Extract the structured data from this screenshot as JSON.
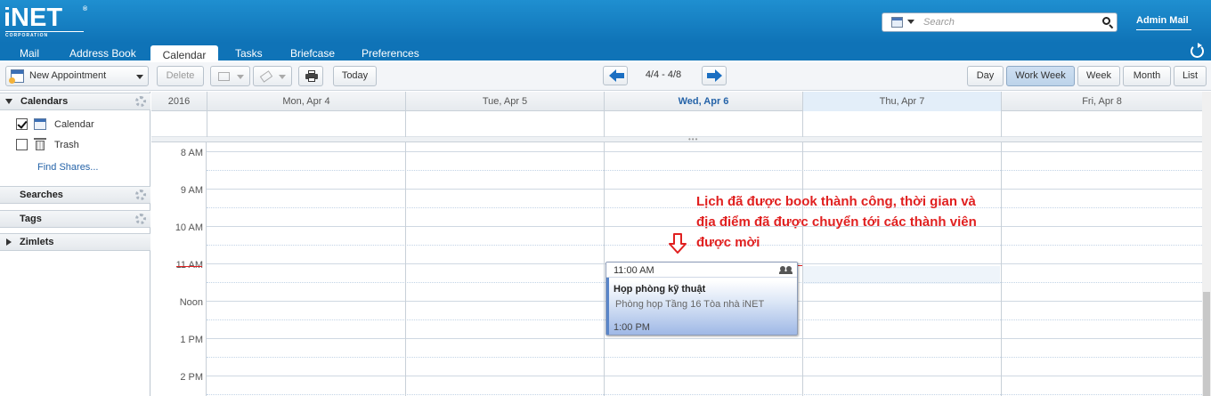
{
  "header": {
    "logo_text": "iNET",
    "logo_sub": "CORPORATION",
    "search": {
      "placeholder": "Search",
      "type_icon": "calendar-icon"
    },
    "user": "Admin Mail"
  },
  "tabs": [
    {
      "label": "Mail"
    },
    {
      "label": "Address Book"
    },
    {
      "label": "Calendar",
      "active": true
    },
    {
      "label": "Tasks"
    },
    {
      "label": "Briefcase"
    },
    {
      "label": "Preferences"
    }
  ],
  "toolbar": {
    "new_appointment": "New Appointment",
    "delete": "Delete",
    "today": "Today",
    "date_range": "4/4 - 4/8",
    "views": [
      "Day",
      "Work Week",
      "Week",
      "Month",
      "List"
    ],
    "active_view": "Work Week"
  },
  "sidebar": {
    "calendars_title": "Calendars",
    "items": [
      {
        "label": "Calendar",
        "checked": true
      },
      {
        "label": "Trash",
        "checked": false
      }
    ],
    "find_shares": "Find Shares...",
    "searches": "Searches",
    "tags": "Tags",
    "zimlets": "Zimlets"
  },
  "calendar": {
    "year": "2016",
    "days": [
      {
        "label": "Mon, Apr 4"
      },
      {
        "label": "Tue, Apr 5"
      },
      {
        "label": "Wed, Apr 6",
        "today": true
      },
      {
        "label": "Thu, Apr 7",
        "selected": true
      },
      {
        "label": "Fri, Apr 8"
      }
    ],
    "hours": [
      "8 AM",
      "9 AM",
      "10 AM",
      "11 AM",
      "Noon",
      "1 PM",
      "2 PM"
    ]
  },
  "appointment": {
    "start": "11:00 AM",
    "title": "Họp phòng kỹ thuật",
    "location": "Phòng họp Tầng 16 Tòa nhà iNET",
    "end": "1:00 PM"
  },
  "annotation": {
    "text": "Lịch đã được book thành công, thời gian và địa điểm đã được chuyển tới các thành viên được mời",
    "color": "#e02020"
  },
  "colors": {
    "header": "#0f73b7",
    "accent": "#1b6fc2"
  }
}
